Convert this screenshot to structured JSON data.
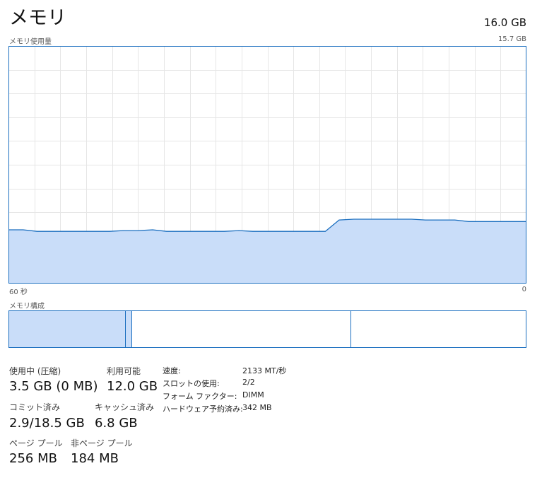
{
  "header": {
    "title": "メモリ",
    "total": "16.0 GB"
  },
  "chart": {
    "label": "メモリ使用量",
    "max_label": "15.7 GB",
    "x_left": "60 秒",
    "x_right": "0"
  },
  "chart_data": {
    "type": "area",
    "ylim": [
      0,
      15.7
    ],
    "x": [
      60,
      58.3,
      56.7,
      55,
      53.3,
      51.7,
      50,
      48.3,
      46.7,
      45,
      43.3,
      41.7,
      40,
      38.3,
      36.7,
      35,
      33.3,
      31.7,
      30,
      28.3,
      26.7,
      25,
      23.3,
      21.7,
      20,
      18.3,
      16.7,
      15,
      13.3,
      11.7,
      10,
      8.3,
      6.7,
      5,
      3.3,
      1.7,
      0
    ],
    "series": [
      {
        "values": [
          3.55,
          3.55,
          3.45,
          3.45,
          3.45,
          3.45,
          3.45,
          3.45,
          3.5,
          3.5,
          3.55,
          3.45,
          3.45,
          3.45,
          3.45,
          3.45,
          3.5,
          3.45,
          3.45,
          3.45,
          3.45,
          3.45,
          3.45,
          4.2,
          4.25,
          4.25,
          4.25,
          4.25,
          4.25,
          4.2,
          4.2,
          4.2,
          4.1,
          4.1,
          4.1,
          4.1,
          4.1
        ]
      }
    ],
    "grid": true,
    "color": "#c9ddf9",
    "line_color": "#1a6ebf"
  },
  "composition": {
    "label": "メモリ構成",
    "segments": [
      {
        "name": "in-use",
        "fraction": 0.225
      },
      {
        "name": "modified",
        "fraction": 0.013
      },
      {
        "name": "standby",
        "fraction": 0.422
      },
      {
        "name": "free",
        "fraction": 0.34
      }
    ]
  },
  "stats": {
    "in_use_label": "使用中 (圧縮)",
    "in_use_value": "3.5 GB (0 MB)",
    "available_label": "利用可能",
    "available_value": "12.0 GB",
    "committed_label": "コミット済み",
    "committed_value": "2.9/18.5 GB",
    "cached_label": "キャッシュ済み",
    "cached_value": "6.8 GB",
    "paged_label": "ページ プール",
    "paged_value": "256 MB",
    "nonpaged_label": "非ページ プール",
    "nonpaged_value": "184 MB"
  },
  "details": [
    {
      "key": "速度:",
      "value": "2133 MT/秒"
    },
    {
      "key": "スロットの使用:",
      "value": "2/2"
    },
    {
      "key": "フォーム ファクター:",
      "value": "DIMM"
    },
    {
      "key": "ハードウェア予約済み:",
      "value": "342 MB"
    }
  ]
}
